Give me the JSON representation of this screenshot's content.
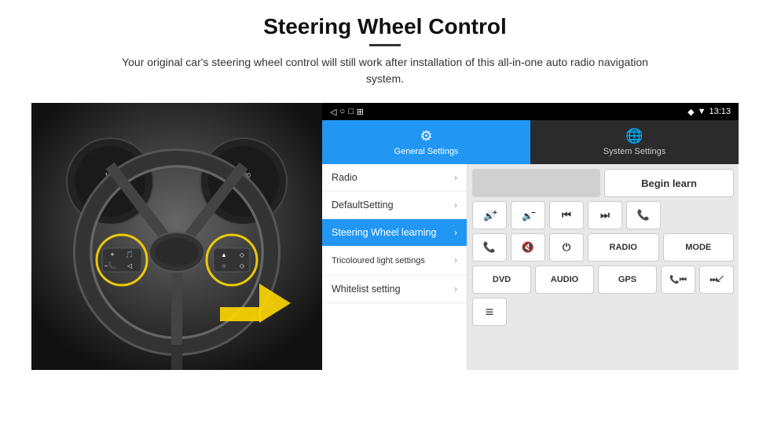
{
  "page": {
    "title": "Steering Wheel Control",
    "subtitle": "Your original car's steering wheel control will still work after installation of this all-in-one auto radio navigation system."
  },
  "status_bar": {
    "time": "13:13",
    "nav_symbols": [
      "◁",
      "○",
      "□",
      "⊞"
    ]
  },
  "tabs": [
    {
      "id": "general",
      "label": "General Settings",
      "icon": "⚙",
      "active": true
    },
    {
      "id": "system",
      "label": "System Settings",
      "icon": "🌐",
      "active": false
    }
  ],
  "menu_items": [
    {
      "id": "radio",
      "label": "Radio",
      "active": false
    },
    {
      "id": "default",
      "label": "DefaultSetting",
      "active": false
    },
    {
      "id": "steering",
      "label": "Steering Wheel learning",
      "active": true
    },
    {
      "id": "tricoloured",
      "label": "Tricoloured light settings",
      "active": false
    },
    {
      "id": "whitelist",
      "label": "Whitelist setting",
      "active": false
    }
  ],
  "control_buttons": {
    "row1": [
      {
        "id": "empty",
        "label": "",
        "type": "empty-wide"
      },
      {
        "id": "begin-learn",
        "label": "Begin learn",
        "type": "begin-learn"
      }
    ],
    "row2": [
      {
        "id": "vol-up",
        "label": "🔊+",
        "type": "square"
      },
      {
        "id": "vol-down",
        "label": "🔉−",
        "type": "square"
      },
      {
        "id": "prev-track",
        "label": "⏮",
        "type": "square"
      },
      {
        "id": "next-track",
        "label": "⏭",
        "type": "square"
      },
      {
        "id": "phone",
        "label": "📞",
        "type": "square"
      }
    ],
    "row3": [
      {
        "id": "call-accept",
        "label": "📞",
        "type": "square"
      },
      {
        "id": "mute",
        "label": "🔇",
        "type": "square"
      },
      {
        "id": "power",
        "label": "⏻",
        "type": "square"
      },
      {
        "id": "radio-btn",
        "label": "RADIO",
        "type": "wide"
      },
      {
        "id": "mode",
        "label": "MODE",
        "type": "wide"
      }
    ],
    "row4": [
      {
        "id": "dvd",
        "label": "DVD",
        "type": "wide"
      },
      {
        "id": "audio",
        "label": "AUDIO",
        "type": "wide"
      },
      {
        "id": "gps",
        "label": "GPS",
        "type": "wide"
      },
      {
        "id": "phone2",
        "label": "📞⏮",
        "type": "wide"
      },
      {
        "id": "skip",
        "label": "⏭↙",
        "type": "wide"
      }
    ],
    "row5": [
      {
        "id": "list-icon",
        "label": "≡",
        "type": "square"
      }
    ]
  }
}
